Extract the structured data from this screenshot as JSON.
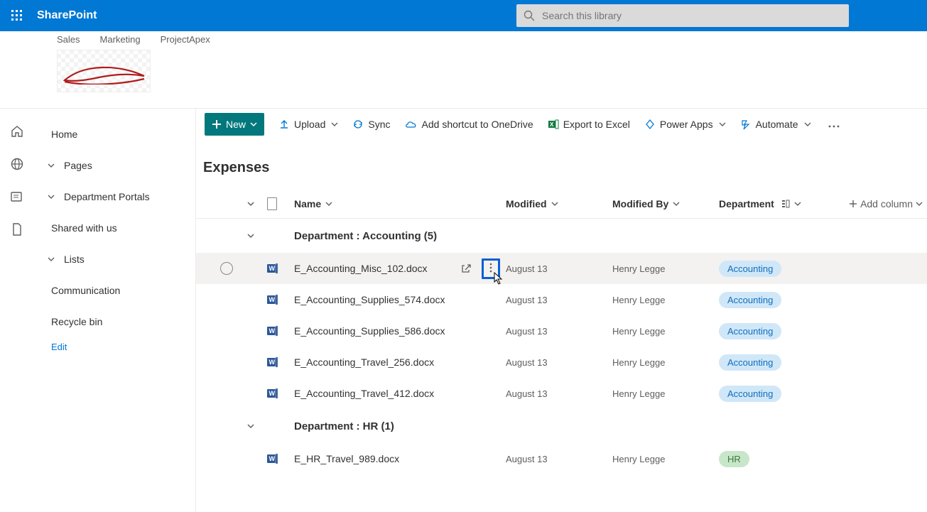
{
  "header": {
    "brand": "SharePoint",
    "search_placeholder": "Search this library"
  },
  "hub": {
    "links": [
      "Sales",
      "Marketing",
      "ProjectApex"
    ]
  },
  "sidenav": {
    "home": "Home",
    "pages": "Pages",
    "deptportals": "Department Portals",
    "shared": "Shared with us",
    "lists": "Lists",
    "communication": "Communication",
    "recycle": "Recycle bin",
    "edit": "Edit"
  },
  "cmd": {
    "new": "New",
    "upload": "Upload",
    "sync": "Sync",
    "shortcut": "Add shortcut to OneDrive",
    "export": "Export to Excel",
    "powerapps": "Power Apps",
    "automate": "Automate"
  },
  "list": {
    "title": "Expenses",
    "cols": {
      "name": "Name",
      "modified": "Modified",
      "modifiedby": "Modified By",
      "department": "Department",
      "addcol": "Add column"
    },
    "groups": [
      {
        "label": "Department : Accounting (5)",
        "dept_pill": "Accounting",
        "pill_class": "acc",
        "rows": [
          {
            "name": "E_Accounting_Misc_102.docx",
            "modified": "August 13",
            "by": "Henry Legge",
            "hover": true
          },
          {
            "name": "E_Accounting_Supplies_574.docx",
            "modified": "August 13",
            "by": "Henry Legge"
          },
          {
            "name": "E_Accounting_Supplies_586.docx",
            "modified": "August 13",
            "by": "Henry Legge"
          },
          {
            "name": "E_Accounting_Travel_256.docx",
            "modified": "August 13",
            "by": "Henry Legge"
          },
          {
            "name": "E_Accounting_Travel_412.docx",
            "modified": "August 13",
            "by": "Henry Legge"
          }
        ]
      },
      {
        "label": "Department : HR (1)",
        "dept_pill": "HR",
        "pill_class": "hr",
        "rows": [
          {
            "name": "E_HR_Travel_989.docx",
            "modified": "August 13",
            "by": "Henry Legge"
          }
        ]
      }
    ]
  }
}
